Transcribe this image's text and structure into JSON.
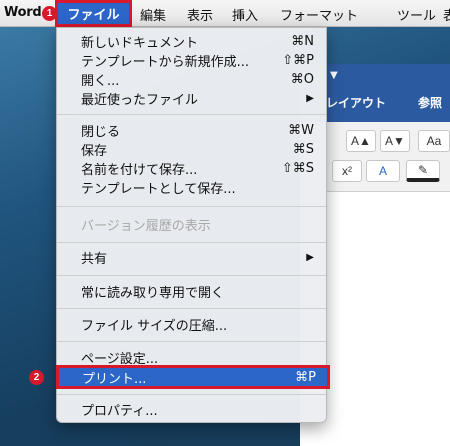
{
  "menubar": {
    "app_name": "Word",
    "items": [
      "ファイル",
      "編集",
      "表示",
      "挿入",
      "フォーマット",
      "ツール",
      "表"
    ],
    "badge1": "1",
    "badge2": "2"
  },
  "word_window": {
    "qa_arrow": "▼",
    "tabs": [
      "レイアウト",
      "参照"
    ],
    "buttons": [
      "A▲",
      "A▼",
      "Aa",
      "x²",
      "A",
      "✎"
    ]
  },
  "menu": {
    "new_document": {
      "label": "新しいドキュメント",
      "shortcut": "⌘N"
    },
    "new_from_template": {
      "label": "テンプレートから新規作成...",
      "shortcut": "⇧⌘P"
    },
    "open": {
      "label": "開く...",
      "shortcut": "⌘O"
    },
    "recent": {
      "label": "最近使ったファイル",
      "arrow": "▶"
    },
    "close": {
      "label": "閉じる",
      "shortcut": "⌘W"
    },
    "save": {
      "label": "保存",
      "shortcut": "⌘S"
    },
    "save_as": {
      "label": "名前を付けて保存...",
      "shortcut": "⇧⌘S"
    },
    "save_template": {
      "label": "テンプレートとして保存..."
    },
    "version_history": {
      "label": "バージョン履歴の表示"
    },
    "share": {
      "label": "共有",
      "arrow": "▶"
    },
    "open_readonly": {
      "label": "常に読み取り専用で開く"
    },
    "compress": {
      "label": "ファイル サイズの圧縮..."
    },
    "page_setup": {
      "label": "ページ設定..."
    },
    "print": {
      "label": "プリント...",
      "shortcut": "⌘P"
    },
    "properties": {
      "label": "プロパティ..."
    }
  },
  "colors": {
    "highlight": "#2c66c9",
    "callout_red": "#d8182b",
    "ribbon_blue": "#2c5aa0"
  }
}
